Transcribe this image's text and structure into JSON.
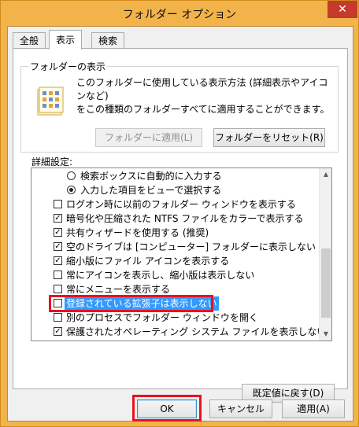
{
  "window": {
    "title": "フォルダー オプション",
    "close_label": "✕"
  },
  "tabs": [
    {
      "label": "全般",
      "active": false
    },
    {
      "label": "表示",
      "active": true
    },
    {
      "label": "検索",
      "active": false
    }
  ],
  "folder_view": {
    "group_label": "フォルダーの表示",
    "description_line1": "このフォルダーに使用している表示方法 (詳細表示やアイコンなど)",
    "description_line2": "をこの種類のフォルダーすべてに適用することができます。",
    "apply_button": "フォルダーに適用(L)",
    "reset_button": "フォルダーをリセット(R)"
  },
  "advanced": {
    "label": "詳細設定:",
    "items": [
      {
        "type": "radio",
        "checked": false,
        "text": "検索ボックスに自動的に入力する"
      },
      {
        "type": "radio",
        "checked": true,
        "text": "入力した項目をビューで選択する"
      },
      {
        "type": "checkbox",
        "checked": false,
        "text": "ログオン時に以前のフォルダー ウィンドウを表示する"
      },
      {
        "type": "checkbox",
        "checked": true,
        "text": "暗号化や圧縮された NTFS ファイルをカラーで表示する"
      },
      {
        "type": "checkbox",
        "checked": true,
        "text": "共有ウィザードを使用する (推奨)"
      },
      {
        "type": "checkbox",
        "checked": true,
        "text": "空のドライブは [コンピューター] フォルダーに表示しない"
      },
      {
        "type": "checkbox",
        "checked": true,
        "text": "縮小版にファイル アイコンを表示する"
      },
      {
        "type": "checkbox",
        "checked": false,
        "text": "常にアイコンを表示し、縮小版は表示しない"
      },
      {
        "type": "checkbox",
        "checked": false,
        "text": "常にメニューを表示する"
      },
      {
        "type": "checkbox",
        "checked": false,
        "text": "登録されている拡張子は表示しない",
        "selected": true
      },
      {
        "type": "checkbox",
        "checked": false,
        "text": "別のプロセスでフォルダー ウィンドウを開く"
      },
      {
        "type": "checkbox",
        "checked": true,
        "text": "保護されたオペレーティング システム ファイルを表示しない (推奨)"
      }
    ],
    "check_mark": "✓",
    "restore_defaults_button": "既定値に戻す(D)"
  },
  "footer": {
    "ok_button": "OK",
    "cancel_button": "キャンセル",
    "apply_button": "適用(A)"
  },
  "icons": {
    "scroll_up": "▲",
    "scroll_down": "▼"
  },
  "colors": {
    "highlight": "#e8121f",
    "selection": "#3399ff",
    "frame": "#f2b34a"
  }
}
